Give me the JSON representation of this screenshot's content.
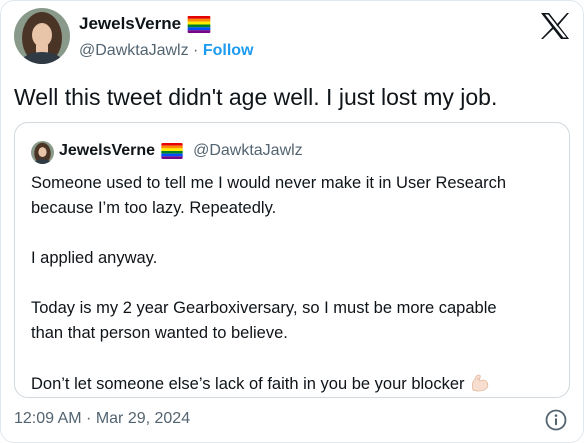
{
  "author": {
    "display_name": "JewelsVerne",
    "handle": "@DawktaJawlz",
    "separator": " · ",
    "follow_label": "Follow",
    "avatar": "woman-long-hair-avatar"
  },
  "platform_logo": "x-logo-icon",
  "tweet": {
    "text": "Well this tweet didn't age well. I just lost my job."
  },
  "quoted_tweet": {
    "display_name": "JewelsVerne",
    "handle": "@DawktaJawlz",
    "paragraphs": [
      "Someone used to tell me I would never make it in User Research",
      "because I’m too lazy. Repeatedly.",
      "",
      "I applied anyway.",
      "",
      "Today is my 2 year Gearboxiversary, so I must be more capable",
      "than that person wanted to believe.",
      "",
      "Don’t let someone else’s lack of faith in you be your blocker"
    ],
    "trailing_emoji": "flexed-biceps-icon"
  },
  "timestamp": "12:09 AM · Mar 29, 2024",
  "colors": {
    "accent": "#1d9bf0",
    "text": "#0f1419",
    "secondary": "#536471",
    "border": "#cfd9de"
  }
}
